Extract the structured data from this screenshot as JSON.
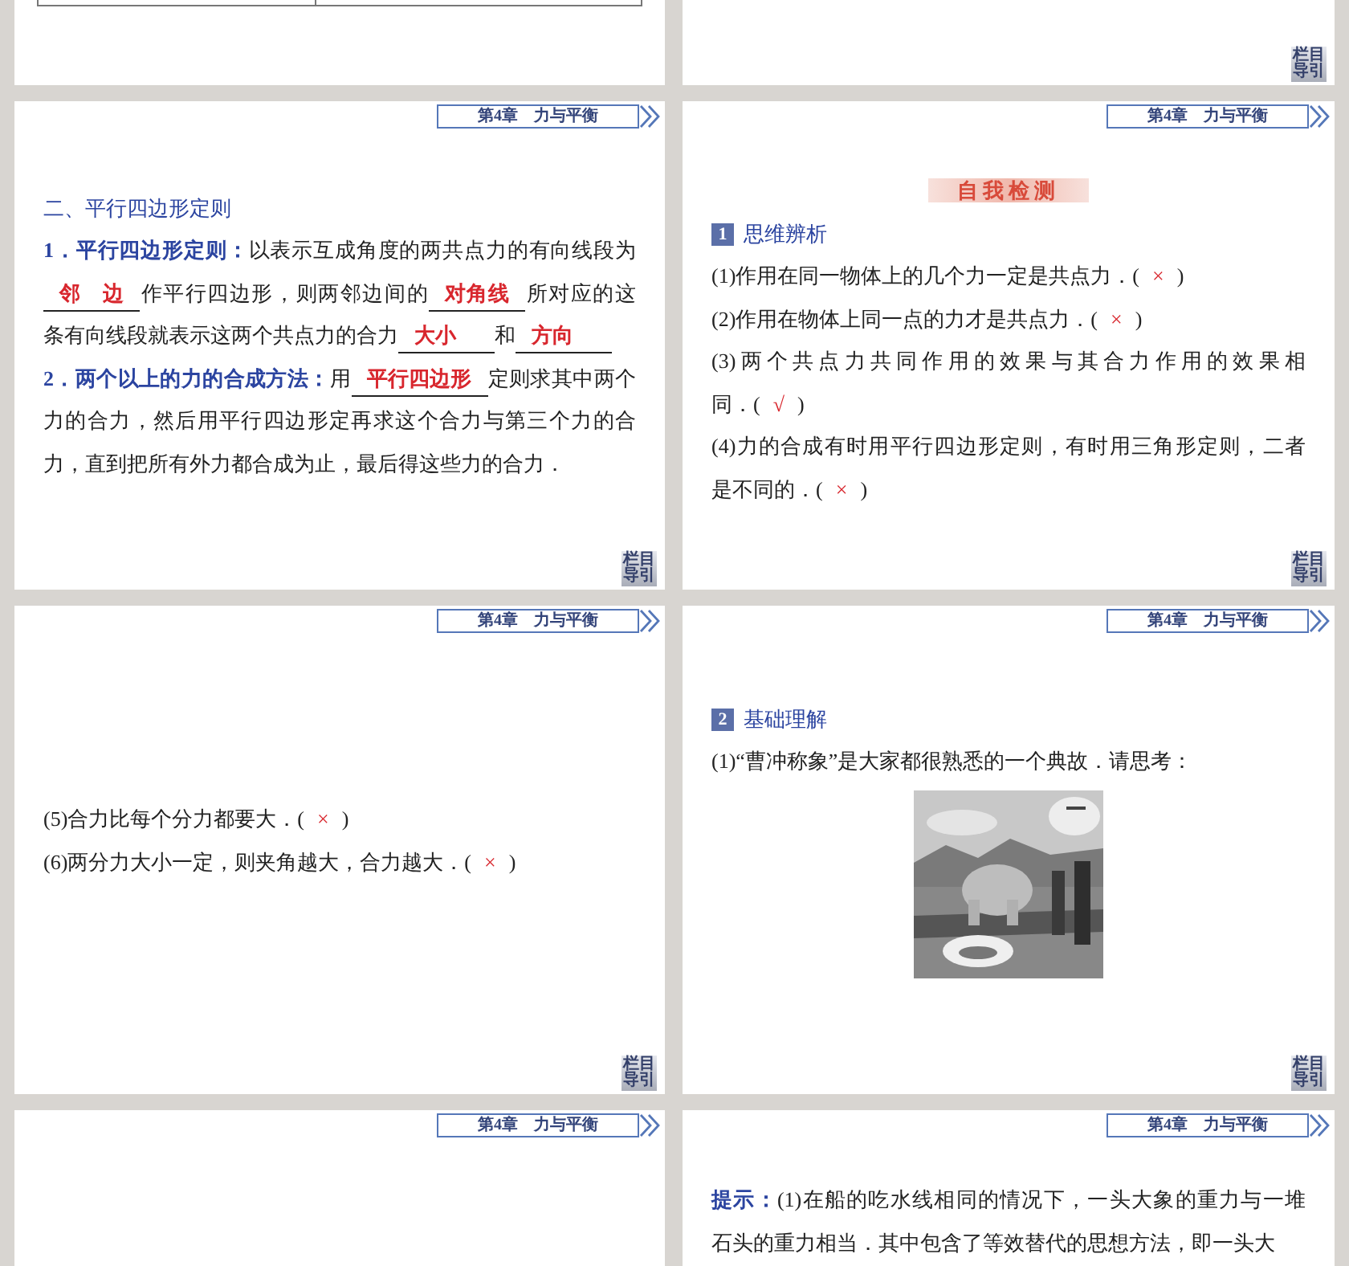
{
  "slides": [
    {
      "kind": "table_end"
    },
    {
      "kind": "blank",
      "nav": "栏目导引"
    },
    {
      "kind": "theorem",
      "header": "第4章　力与平衡",
      "nav": "栏目导引",
      "title": "二、平行四边形定则",
      "paragraphs": [
        {
          "lines": [
            [
              {
                "kind": "label",
                "text": "1．平行四边形定则："
              },
              {
                "kind": "text",
                "text": "以表示互成角度的两共点力的有向线段为"
              }
            ],
            [
              {
                "kind": "blank",
                "text": "邻边"
              },
              {
                "kind": "text",
                "text": "作平行四边形，则两邻边间的"
              },
              {
                "kind": "blank",
                "text": "对角线"
              },
              {
                "kind": "text",
                "text": "所对应的这"
              }
            ],
            [
              {
                "kind": "text",
                "text": "条有向线段就表示这两个共点力的合力"
              },
              {
                "kind": "blank",
                "text": "大小"
              },
              {
                "kind": "text",
                "text": "和"
              },
              {
                "kind": "blank",
                "text": "方向"
              }
            ]
          ]
        },
        {
          "lines": [
            [
              {
                "kind": "label",
                "text": "2．两个以上的力的合成方法："
              },
              {
                "kind": "text",
                "text": "用"
              },
              {
                "kind": "blank",
                "text": "平行四边形"
              },
              {
                "kind": "text",
                "text": "定则求其中两个"
              }
            ],
            [
              {
                "kind": "text",
                "text": "力的合力，然后用平行四边形定再求这个合力与第三个力的合"
              }
            ],
            [
              {
                "kind": "text",
                "text": "力，直到把所有外力都合成为止，最后得这些力的合力．"
              }
            ]
          ]
        }
      ]
    },
    {
      "kind": "self_check",
      "header": "第4章　力与平衡",
      "nav": "栏目导引",
      "banner": "自我检测",
      "section": {
        "number": "1",
        "title": "思维辨析"
      },
      "paragraphs": [
        {
          "lines": [
            [
              {
                "kind": "text",
                "text": "(1)作用在同一物体上的几个力一定是共点力．("
              },
              {
                "kind": "answer",
                "text": "×"
              },
              {
                "kind": "text",
                "text": ")"
              }
            ]
          ]
        },
        {
          "lines": [
            [
              {
                "kind": "text",
                "text": "(2)作用在物体上同一点的力才是共点力．("
              },
              {
                "kind": "answer",
                "text": "×"
              },
              {
                "kind": "text",
                "text": ")"
              }
            ]
          ]
        },
        {
          "lines": [
            [
              {
                "kind": "text",
                "text": "(3)两个共点力共同作用的效果与其合力作用的效果相"
              }
            ],
            [
              {
                "kind": "text",
                "text": "同．("
              },
              {
                "kind": "answer",
                "text": "√"
              },
              {
                "kind": "text",
                "text": ")"
              }
            ]
          ]
        },
        {
          "lines": [
            [
              {
                "kind": "text",
                "text": "(4)力的合成有时用平行四边形定则，有时用三角形定则，二者"
              }
            ],
            [
              {
                "kind": "text",
                "text": "是不同的．("
              },
              {
                "kind": "answer",
                "text": "×"
              },
              {
                "kind": "text",
                "text": ")"
              }
            ]
          ]
        }
      ]
    },
    {
      "kind": "questions",
      "header": "第4章　力与平衡",
      "nav": "栏目导引",
      "paragraphs": [
        {
          "lines": [
            [
              {
                "kind": "text",
                "text": "(5)合力比每个分力都要大．("
              },
              {
                "kind": "answer",
                "text": "×"
              },
              {
                "kind": "text",
                "text": ")"
              }
            ]
          ]
        },
        {
          "lines": [
            [
              {
                "kind": "text",
                "text": "(6)两分力大小一定，则夹角越大，合力越大．("
              },
              {
                "kind": "answer",
                "text": "×"
              },
              {
                "kind": "text",
                "text": ")"
              }
            ]
          ]
        }
      ]
    },
    {
      "kind": "basics",
      "header": "第4章　力与平衡",
      "nav": "栏目导引",
      "section": {
        "number": "2",
        "title": "基础理解"
      },
      "paragraphs": [
        {
          "lines": [
            [
              {
                "kind": "text",
                "text": "(1)“曹冲称象”是大家都很熟悉的一个典故．请思考："
              }
            ]
          ]
        }
      ],
      "picture": {
        "kind": "picture"
      }
    },
    {
      "kind": "empty",
      "header": "第4章　力与平衡"
    },
    {
      "kind": "hint",
      "header": "第4章　力与平衡",
      "paragraphs": [
        {
          "lines": [
            [
              {
                "kind": "label",
                "text": "提示："
              },
              {
                "kind": "text",
                "text": "(1)在船的吃水线相同的情况下，一头大象的重力与一堆"
              }
            ],
            [
              {
                "kind": "text",
                "text": "石头的重力相当．其中包含了等效替代的思想方法，即一头大"
              }
            ]
          ]
        }
      ]
    }
  ]
}
